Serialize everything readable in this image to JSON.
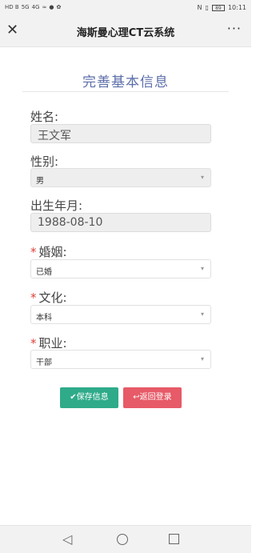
{
  "status_bar": {
    "left_glyphs": [
      "HD B",
      "5G",
      "4G",
      "wifi",
      "chat",
      "paw"
    ],
    "right_icons": [
      "N",
      "vibrate"
    ],
    "battery": "89",
    "time": "10:11"
  },
  "navbar": {
    "close_icon": "close-icon",
    "title": "海斯曼心理CT云系统",
    "more_label": "···"
  },
  "page": {
    "title": "完善基本信息"
  },
  "form": {
    "name": {
      "label": "姓名:",
      "value": "王文军"
    },
    "gender": {
      "label": "性别:",
      "value": "男"
    },
    "birth": {
      "label": "出生年月:",
      "value": "1988-08-10"
    },
    "marriage": {
      "required": "*",
      "label": "婚姻:",
      "value": "已婚"
    },
    "education": {
      "required": "*",
      "label": "文化:",
      "value": "本科"
    },
    "occupation": {
      "required": "*",
      "label": "职业:",
      "value": "干部"
    }
  },
  "buttons": {
    "save_label": "✔保存信息",
    "back_label": "↩返回登录"
  },
  "colors": {
    "accent_title": "#5b6ea9",
    "save": "#2fab8a",
    "back": "#e75a67",
    "required": "#e0423c"
  },
  "system_nav": {
    "back": "◁"
  }
}
